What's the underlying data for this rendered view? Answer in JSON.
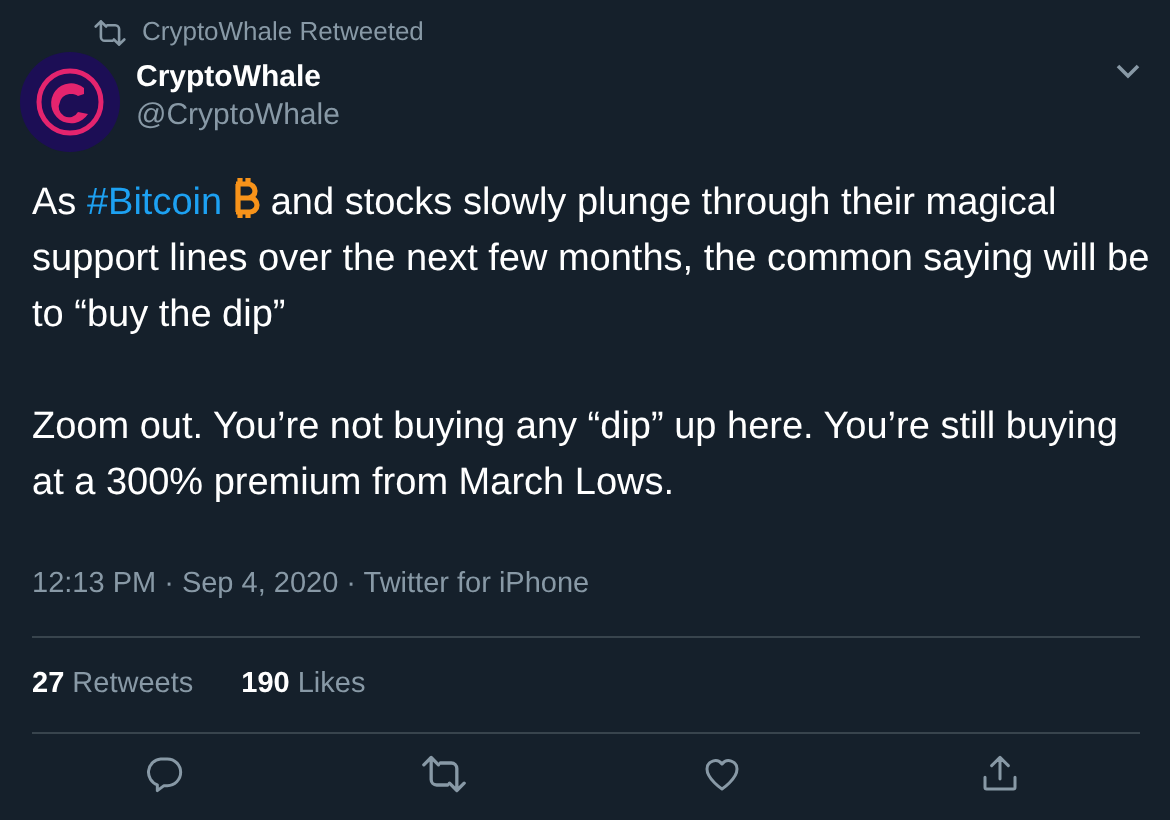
{
  "retweet_banner": {
    "text": "CryptoWhale Retweeted"
  },
  "author": {
    "name": "CryptoWhale",
    "handle": "@CryptoWhale"
  },
  "tweet": {
    "paragraphs": [
      {
        "segments": [
          {
            "kind": "text",
            "text": "As "
          },
          {
            "kind": "hashtag",
            "text": "#Bitcoin"
          },
          {
            "kind": "text",
            "text": " and stocks slowly plunge through their magical support lines over the next few months, the common saying will be to “buy the dip”"
          }
        ]
      },
      {
        "segments": [
          {
            "kind": "text",
            "text": "Zoom out. You’re not buying any “dip” up here. You’re still buying at a 300% premium from March Lows."
          }
        ]
      }
    ]
  },
  "meta": "12:13 PM · Sep 4, 2020 · Twitter for iPhone",
  "stats": [
    {
      "count": "27",
      "label": "Retweets"
    },
    {
      "count": "190",
      "label": "Likes"
    }
  ]
}
